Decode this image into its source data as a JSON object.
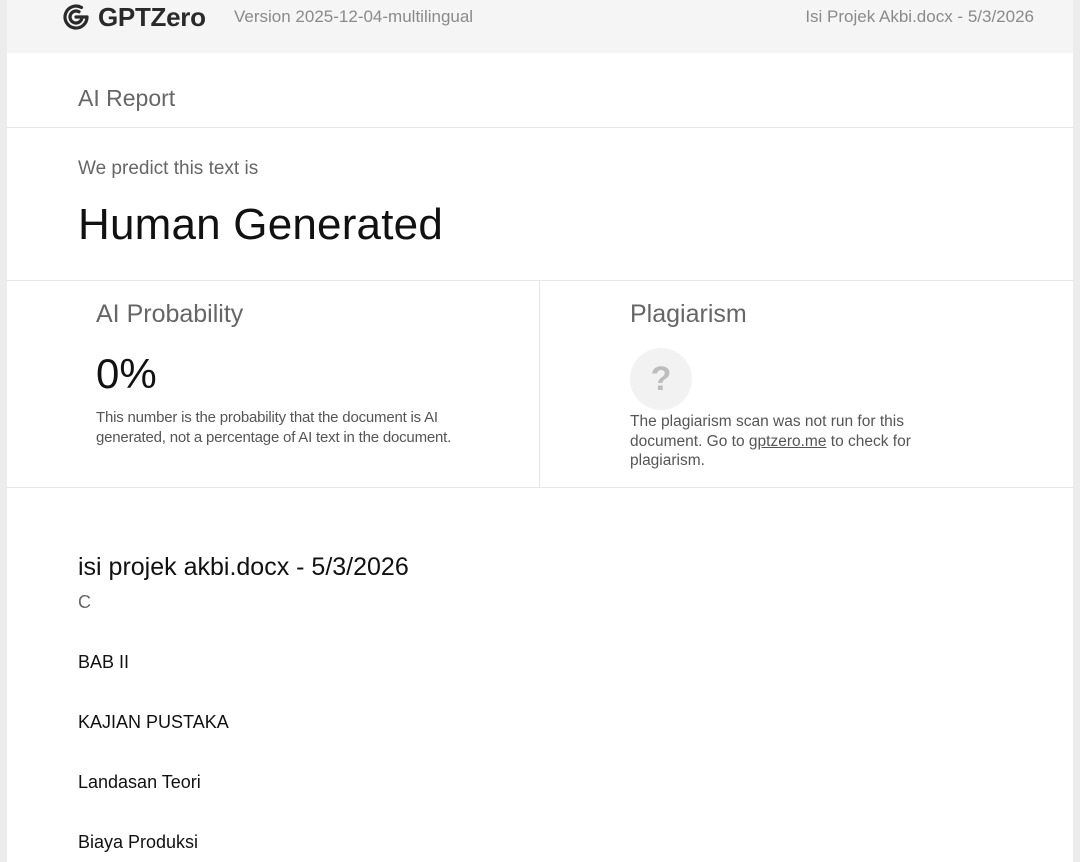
{
  "header": {
    "brand": "GPTZero",
    "version": "Version 2025-12-04-multilingual",
    "document_meta": "Isi Projek Akbi.docx - 5/3/2026"
  },
  "report": {
    "section_title": "AI Report",
    "predict_label": "We predict this text is",
    "predict_value": "Human Generated"
  },
  "ai_probability": {
    "title": "AI Probability",
    "value": "0%",
    "note": "This number is the probability that the document is AI generated, not a percentage of AI text in the document."
  },
  "plagiarism": {
    "title": "Plagiarism",
    "icon": "question-mark-icon",
    "note_before": "The plagiarism scan was not run for this document. Go to ",
    "link_text": "gptzero.me",
    "note_after": " to check for plagiarism."
  },
  "document": {
    "title": "isi projek akbi.docx - 5/3/2026",
    "subtitle": "C",
    "paragraphs": [
      "BAB II",
      "KAJIAN PUSTAKA",
      "Landasan Teori",
      "Biaya Produksi"
    ]
  },
  "colors": {
    "header_bg": "#f5f5f5",
    "muted_text": "#666666",
    "primary_text": "#111111"
  }
}
